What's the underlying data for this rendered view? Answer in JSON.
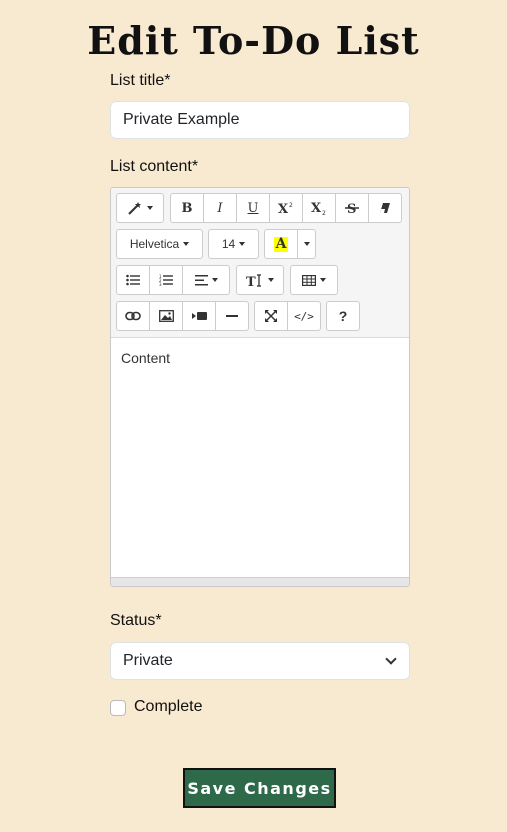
{
  "page": {
    "title": "Edit To-Do List"
  },
  "form": {
    "title_label": "List title*",
    "title_value": "Private Example",
    "content_label": "List content*",
    "status_label": "Status*",
    "status_value": "Private",
    "complete_label": "Complete",
    "save_label": "Save Changes"
  },
  "editor": {
    "font_name": "Helvetica",
    "font_size": "14",
    "content": "Content",
    "bold": "B",
    "italic": "I",
    "underline": "U",
    "help": "?",
    "code": "</>",
    "highlight_letter": "A",
    "highlight_color": "#ffff00"
  },
  "colors": {
    "background": "#f8ead0",
    "save_button": "#2e6a4a"
  }
}
